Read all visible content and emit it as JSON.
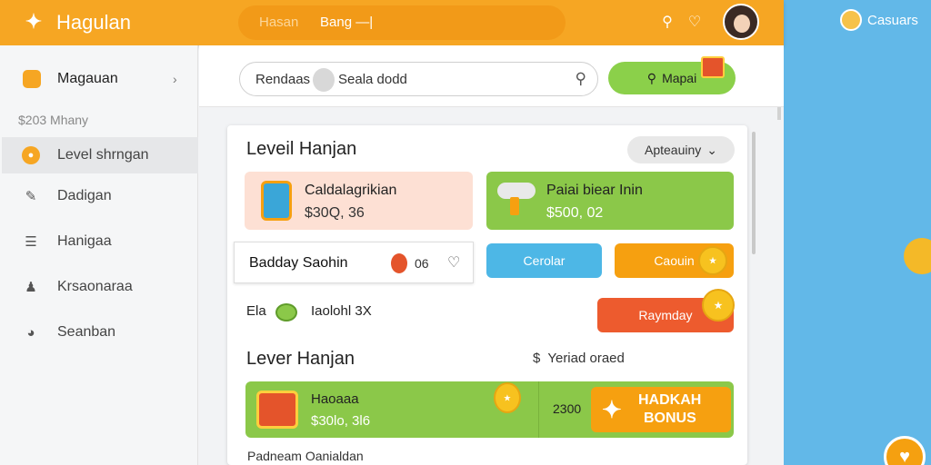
{
  "header": {
    "title": "Hagulan",
    "tabs": [
      "Hasan",
      "Bang —|"
    ]
  },
  "sidebar": {
    "top_item": "Magauan",
    "stat": "$203 Mhany",
    "items": [
      {
        "label": "Level shrngan",
        "icon": "coin-icon",
        "active": true
      },
      {
        "label": "Dadigan",
        "icon": "megaphone-icon",
        "active": false
      },
      {
        "label": "Hanigaa",
        "icon": "layers-icon",
        "active": false
      },
      {
        "label": "Krsaonaraa",
        "icon": "person-icon",
        "active": false
      },
      {
        "label": "Seanban",
        "icon": "clock-icon",
        "active": false
      }
    ]
  },
  "search": {
    "lead": "Rendaas",
    "value": "Seala dodd"
  },
  "map_button": "Mapai",
  "section1": {
    "title": "Leveil Hanjan",
    "dropdown": "Apteauiny"
  },
  "tiles": [
    {
      "title": "Caldalagrikian",
      "value": "$30Q, 36"
    },
    {
      "title": "Paiai biear Inin",
      "value": "$500, 02"
    }
  ],
  "row_card": {
    "title": "Badday Saohin",
    "count": "06"
  },
  "buttons": {
    "blue": "Cerolar",
    "orange": "Caouin",
    "red": "Raymday"
  },
  "stats": {
    "left": "Ela",
    "right": "Iaolohl 3X"
  },
  "section2": {
    "title": "Lever Hanjan",
    "side": "Yeriad oraed",
    "side_icon": "$"
  },
  "bonus": {
    "title": "Haoaaa",
    "value": "$30lo, 3l6",
    "amount": "2300",
    "button_line1": "HADKAH",
    "button_line2": "BONUS"
  },
  "footer_text": "Padneam Oanialdan",
  "right_panel": {
    "user": "Casuars"
  },
  "colors": {
    "brand_orange": "#f6a623",
    "green": "#8bc849",
    "sky": "#62b8e8",
    "red": "#ed5b2e"
  }
}
